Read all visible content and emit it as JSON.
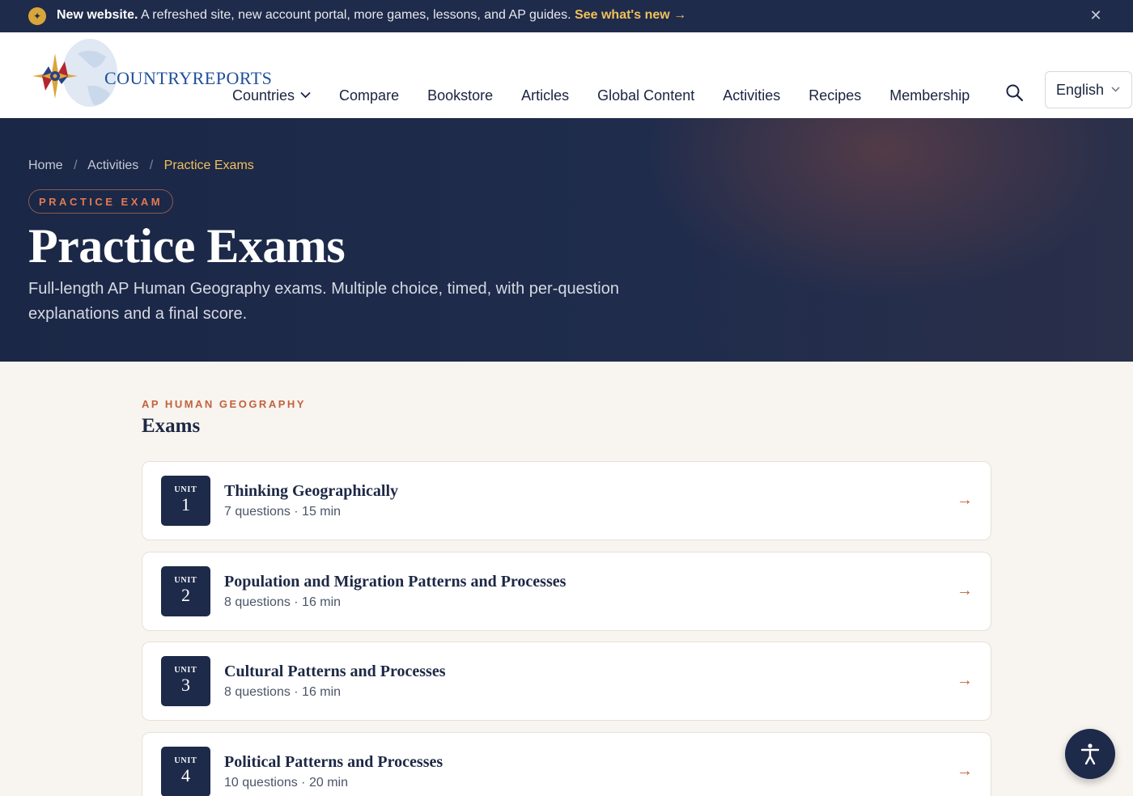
{
  "announcement": {
    "icon": "sparkle-icon",
    "bold": "New website.",
    "text": "A refreshed site, new account portal, more games, lessons, and AP guides.",
    "link": "See what's new →",
    "close_icon": "close-icon"
  },
  "header": {
    "logo_text": "COUNTRYREPORTS",
    "nav": [
      {
        "label": "Countries",
        "has_dropdown": true
      },
      {
        "label": "Compare"
      },
      {
        "label": "Bookstore"
      },
      {
        "label": "Articles"
      },
      {
        "label": "Global Content"
      },
      {
        "label": "Activities"
      },
      {
        "label": "Recipes"
      },
      {
        "label": "Membership"
      }
    ],
    "search_icon": "search-icon",
    "language": "English"
  },
  "hero": {
    "breadcrumb": [
      "Home",
      "Activities",
      "Practice Exams"
    ],
    "pill": "PRACTICE EXAM",
    "title": "Practice Exams",
    "subtitle": "Full-length AP Human Geography exams. Multiple choice, timed, with per-question explanations and a final score."
  },
  "section": {
    "kicker": "AP HUMAN GEOGRAPHY",
    "title": "Exams"
  },
  "exams": [
    {
      "unit_label": "UNIT",
      "unit_number": "1",
      "title": "Thinking Geographically",
      "meta": "7 questions · 15 min"
    },
    {
      "unit_label": "UNIT",
      "unit_number": "2",
      "title": "Population and Migration Patterns and Processes",
      "meta": "8 questions · 16 min"
    },
    {
      "unit_label": "UNIT",
      "unit_number": "3",
      "title": "Cultural Patterns and Processes",
      "meta": "8 questions · 16 min"
    },
    {
      "unit_label": "UNIT",
      "unit_number": "4",
      "title": "Political Patterns and Processes",
      "meta": "10 questions · 20 min"
    }
  ],
  "colors": {
    "navy": "#1f2b4b",
    "accent_orange": "#c2623e",
    "gold": "#f1c05a",
    "cream_bg": "#f8f4ef"
  },
  "accessibility_button_icon": "accessibility-icon"
}
